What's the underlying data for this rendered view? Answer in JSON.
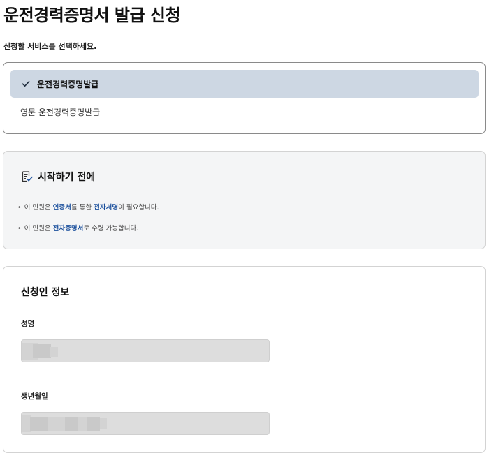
{
  "page": {
    "title": "운전경력증명서 발급 신청",
    "instruction": "신청할 서비스를 선택하세요."
  },
  "service_options": [
    {
      "label": "운전경력증명발급",
      "selected": true
    },
    {
      "label": "영문 운전경력증명발급",
      "selected": false
    }
  ],
  "notice": {
    "icon": "checklist-icon",
    "title": "시작하기 전에",
    "bullets": [
      {
        "pre": "이 민원은 ",
        "hl1": "인증서",
        "mid": "를 통한 ",
        "hl2": "전자서명",
        "post": "이 필요합니다."
      },
      {
        "pre": "이 민원은 ",
        "hl1": "전자증명서",
        "post": "로 수령 가능합니다."
      }
    ]
  },
  "applicant": {
    "title": "신청인 정보",
    "name_label": "성명",
    "birth_label": "생년월일"
  },
  "colors": {
    "selected_bg": "#cdd7e3",
    "highlight": "#1a4f9c",
    "notice_bg": "#f4f5f6"
  }
}
